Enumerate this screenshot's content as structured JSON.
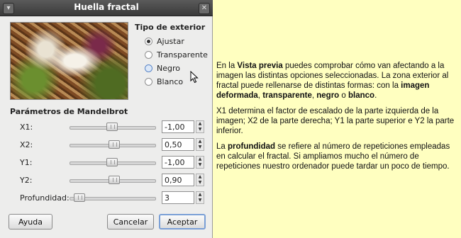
{
  "dialog": {
    "title": "Huella fractal",
    "exterior_title": "Tipo de exterior",
    "exterior_options": [
      {
        "label": "Ajustar",
        "checked": true
      },
      {
        "label": "Transparente",
        "checked": false
      },
      {
        "label": "Negro",
        "checked": false
      },
      {
        "label": "Blanco",
        "checked": false
      }
    ],
    "params_title": "Parámetros de Mandelbrot",
    "params": [
      {
        "label": "X1:",
        "value": "-1,00"
      },
      {
        "label": "X2:",
        "value": "0,50"
      },
      {
        "label": "Y1:",
        "value": "-1,00"
      },
      {
        "label": "Y2:",
        "value": "0,90"
      },
      {
        "label": "Profundidad:",
        "value": "3"
      }
    ],
    "buttons": {
      "help": "Ayuda",
      "cancel": "Cancelar",
      "ok": "Aceptar"
    },
    "icons": [
      "window-menu-icon",
      "close-icon",
      "radio-icon",
      "slider-thumb-icon",
      "spin-arrows-icon",
      "mouse-pointer-icon"
    ]
  },
  "explanation": {
    "p1": {
      "t1": "En la ",
      "b1": "Vista previa",
      "t2": " puedes comprobar cómo van afectando a la imagen las distintas opciones seleccionadas. La zona exterior al fractal puede rellenarse de distintas formas: con la ",
      "b2": "imagen deformada",
      "t3": ", ",
      "b3": "transparente",
      "t4": ", ",
      "b4": "negro",
      "t5": " o ",
      "b5": "blanco",
      "t6": "."
    },
    "p2": "X1 determina el factor de escalado de la parte izquierda de la imagen; X2 de la parte derecha; Y1 la parte superior e Y2 la parte inferior.",
    "p3": {
      "t1": "La ",
      "b1": "profundidad",
      "t2": " se refiere al número de repeticiones empleadas en calcular el fractal. Si ampliamos mucho el número de repeticiones nuestro ordenador puede tardar un poco de tiempo."
    }
  }
}
